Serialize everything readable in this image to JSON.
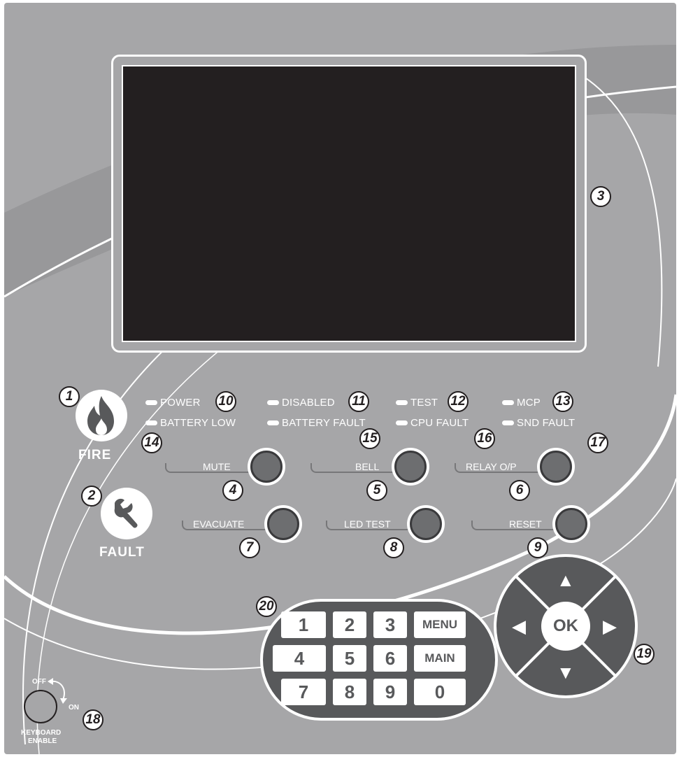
{
  "panel": {
    "background": "#a6a6a8",
    "screen_color": "#231f20",
    "button_color": "#6d6e70",
    "keypad_color": "#58595b"
  },
  "indicators": {
    "fire_label": "FIRE",
    "fault_label": "FAULT"
  },
  "leds": [
    {
      "label": "POWER"
    },
    {
      "label": "DISABLED"
    },
    {
      "label": "TEST"
    },
    {
      "label": "MCP"
    },
    {
      "label": "BATTERY LOW"
    },
    {
      "label": "BATTERY FAULT"
    },
    {
      "label": "CPU FAULT"
    },
    {
      "label": "SND FAULT"
    }
  ],
  "buttons": [
    {
      "label": "MUTE"
    },
    {
      "label": "BELL"
    },
    {
      "label": "RELAY O/P"
    },
    {
      "label": "EVACUATE"
    },
    {
      "label": "LED TEST"
    },
    {
      "label": "RESET"
    }
  ],
  "keypad": {
    "keys": [
      "1",
      "2",
      "3",
      "MENU",
      "4",
      "5",
      "6",
      "MAIN",
      "7",
      "8",
      "9",
      "0"
    ]
  },
  "nav": {
    "ok_label": "OK",
    "up": "▲",
    "down": "▼",
    "left": "◀",
    "right": "▶"
  },
  "keyboard_switch": {
    "off_label": "OFF",
    "on_label": "ON",
    "caption_line1": "KEYBOARD",
    "caption_line2": "ENABLE"
  },
  "callouts": [
    "1",
    "2",
    "3",
    "4",
    "5",
    "6",
    "7",
    "8",
    "9",
    "10",
    "11",
    "12",
    "13",
    "14",
    "15",
    "16",
    "17",
    "18",
    "19",
    "20"
  ]
}
